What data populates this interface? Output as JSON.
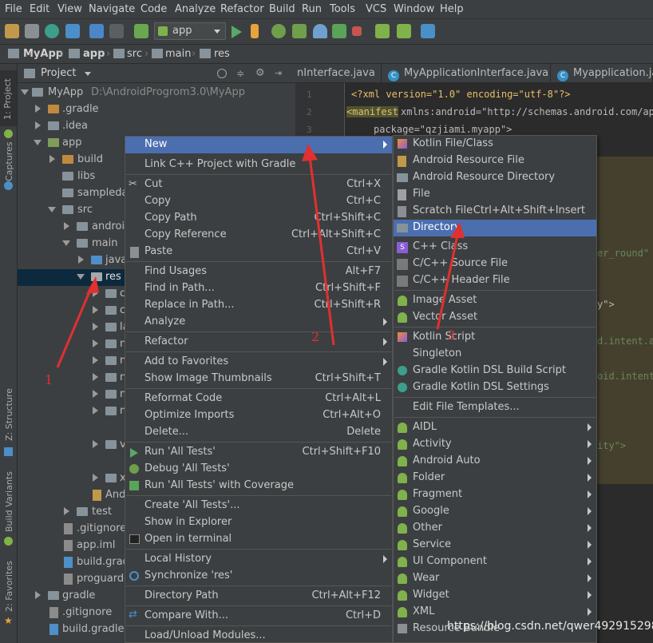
{
  "menubar": [
    "File",
    "Edit",
    "View",
    "Navigate",
    "Code",
    "Analyze",
    "Refactor",
    "Build",
    "Run",
    "Tools",
    "VCS",
    "Window",
    "Help"
  ],
  "toolbar": {
    "run_config": "app"
  },
  "breadcrumb": [
    "MyApp",
    "app",
    "src",
    "main",
    "res"
  ],
  "left_strip": [
    "1: Project",
    "Captures",
    "Z: Structure",
    "Build Variants",
    "2: Favorites"
  ],
  "project_panel": {
    "title": "Project"
  },
  "tree": [
    {
      "label": "MyApp",
      "extra": "D:\\AndroidProgrom3.0\\MyApp"
    },
    {
      "label": ".gradle"
    },
    {
      "label": ".idea"
    },
    {
      "label": "app"
    },
    {
      "label": "build"
    },
    {
      "label": "libs"
    },
    {
      "label": "sampledat"
    },
    {
      "label": "src"
    },
    {
      "label": "androi"
    },
    {
      "label": "main"
    },
    {
      "label": "java"
    },
    {
      "label": "res"
    },
    {
      "label": "c"
    },
    {
      "label": "c"
    },
    {
      "label": "la"
    },
    {
      "label": "n"
    },
    {
      "label": "n"
    },
    {
      "label": "n"
    },
    {
      "label": "n"
    },
    {
      "label": "n"
    },
    {
      "label": "v"
    },
    {
      "label": "x"
    },
    {
      "label": "And"
    },
    {
      "label": "test"
    },
    {
      "label": ".gitignore"
    },
    {
      "label": "app.iml"
    },
    {
      "label": "build.grad"
    },
    {
      "label": "proguard-"
    },
    {
      "label": "gradle"
    },
    {
      "label": ".gitignore"
    },
    {
      "label": "build.gradle"
    }
  ],
  "editor_tabs": [
    "nInterface.java",
    "MyApplicationInterface.java",
    "Myapplication.java"
  ],
  "code": {
    "line_numbers": [
      "1",
      "2",
      "3"
    ],
    "line1": "<?xml version=\"1.0\" encoding=\"utf-8\"?>",
    "line2_tag": "<manifest",
    "line2_rest": " xmlns:android=\"http://schemas.android.com/ap",
    "line3": "package=\"qzjiami.myapp\">",
    "frag1": "er_round\"",
    "frag2": "y\">",
    "frag3": "d.intent.a",
    "frag4": "oid.intent",
    "frag5": "ity\">"
  },
  "context_menu": [
    {
      "label": "New",
      "shortcut": "",
      "submenu": true
    },
    {
      "label": "Link C++ Project with Gradle",
      "shortcut": ""
    },
    {
      "label": "Cut",
      "shortcut": "Ctrl+X"
    },
    {
      "label": "Copy",
      "shortcut": "Ctrl+C"
    },
    {
      "label": "Copy Path",
      "shortcut": "Ctrl+Shift+C"
    },
    {
      "label": "Copy Reference",
      "shortcut": "Ctrl+Alt+Shift+C"
    },
    {
      "label": "Paste",
      "shortcut": "Ctrl+V"
    },
    {
      "label": "Find Usages",
      "shortcut": "Alt+F7"
    },
    {
      "label": "Find in Path...",
      "shortcut": "Ctrl+Shift+F"
    },
    {
      "label": "Replace in Path...",
      "shortcut": "Ctrl+Shift+R"
    },
    {
      "label": "Analyze",
      "shortcut": "",
      "submenu": true
    },
    {
      "label": "Refactor",
      "shortcut": "",
      "submenu": true
    },
    {
      "label": "Add to Favorites",
      "shortcut": "",
      "submenu": true
    },
    {
      "label": "Show Image Thumbnails",
      "shortcut": "Ctrl+Shift+T"
    },
    {
      "label": "Reformat Code",
      "shortcut": "Ctrl+Alt+L"
    },
    {
      "label": "Optimize Imports",
      "shortcut": "Ctrl+Alt+O"
    },
    {
      "label": "Delete...",
      "shortcut": "Delete"
    },
    {
      "label": "Run 'All Tests'",
      "shortcut": "Ctrl+Shift+F10"
    },
    {
      "label": "Debug 'All Tests'",
      "shortcut": ""
    },
    {
      "label": "Run 'All Tests' with Coverage",
      "shortcut": ""
    },
    {
      "label": "Create 'All Tests'...",
      "shortcut": ""
    },
    {
      "label": "Show in Explorer",
      "shortcut": ""
    },
    {
      "label": "Open in terminal",
      "shortcut": ""
    },
    {
      "label": "Local History",
      "shortcut": "",
      "submenu": true
    },
    {
      "label": "Synchronize 'res'",
      "shortcut": ""
    },
    {
      "label": "Directory Path",
      "shortcut": "Ctrl+Alt+F12"
    },
    {
      "label": "Compare With...",
      "shortcut": "Ctrl+D"
    },
    {
      "label": "Load/Unload Modules...",
      "shortcut": ""
    }
  ],
  "new_submenu": [
    {
      "label": "Kotlin File/Class",
      "shortcut": ""
    },
    {
      "label": "Android Resource File",
      "shortcut": ""
    },
    {
      "label": "Android Resource Directory",
      "shortcut": ""
    },
    {
      "label": "File",
      "shortcut": ""
    },
    {
      "label": "Scratch File",
      "shortcut": "Ctrl+Alt+Shift+Insert"
    },
    {
      "label": "Directory",
      "shortcut": ""
    },
    {
      "label": "C++ Class",
      "shortcut": ""
    },
    {
      "label": "C/C++ Source File",
      "shortcut": ""
    },
    {
      "label": "C/C++ Header File",
      "shortcut": ""
    },
    {
      "label": "Image Asset",
      "shortcut": ""
    },
    {
      "label": "Vector Asset",
      "shortcut": ""
    },
    {
      "label": "Kotlin Script",
      "shortcut": ""
    },
    {
      "label": "Singleton",
      "shortcut": ""
    },
    {
      "label": "Gradle Kotlin DSL Build Script",
      "shortcut": ""
    },
    {
      "label": "Gradle Kotlin DSL Settings",
      "shortcut": ""
    },
    {
      "label": "Edit File Templates...",
      "shortcut": ""
    },
    {
      "label": "AIDL",
      "shortcut": ""
    },
    {
      "label": "Activity",
      "shortcut": ""
    },
    {
      "label": "Android Auto",
      "shortcut": ""
    },
    {
      "label": "Folder",
      "shortcut": ""
    },
    {
      "label": "Fragment",
      "shortcut": ""
    },
    {
      "label": "Google",
      "shortcut": ""
    },
    {
      "label": "Other",
      "shortcut": ""
    },
    {
      "label": "Service",
      "shortcut": ""
    },
    {
      "label": "UI Component",
      "shortcut": ""
    },
    {
      "label": "Wear",
      "shortcut": ""
    },
    {
      "label": "Widget",
      "shortcut": ""
    },
    {
      "label": "XML",
      "shortcut": ""
    },
    {
      "label": "Resource Bundle",
      "shortcut": ""
    }
  ],
  "annotations": [
    "1",
    "2",
    "3"
  ],
  "watermark": "https://blog.csdn.net/qwer492915298",
  "colors": {
    "highlight": "#4b6eaf",
    "annotation": "#e03030",
    "bg": "#3c3f41"
  }
}
